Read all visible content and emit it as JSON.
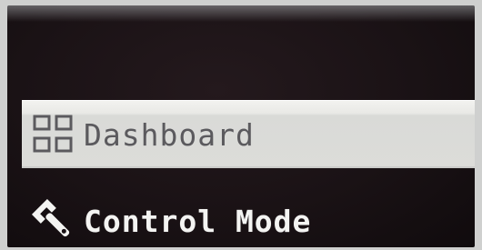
{
  "menu": {
    "items": [
      {
        "label": "Dashboard",
        "icon": "dashboard-grid-icon",
        "selected": true
      },
      {
        "label": "Control Mode",
        "icon": "wrench-icon",
        "selected": false
      }
    ]
  },
  "colors": {
    "screen_background": "#1a1215",
    "selected_background": "#dcdcd9",
    "selected_text": "#5b5a5e",
    "normal_text": "#f4f4f2",
    "bezel": "#cfd0cf"
  }
}
